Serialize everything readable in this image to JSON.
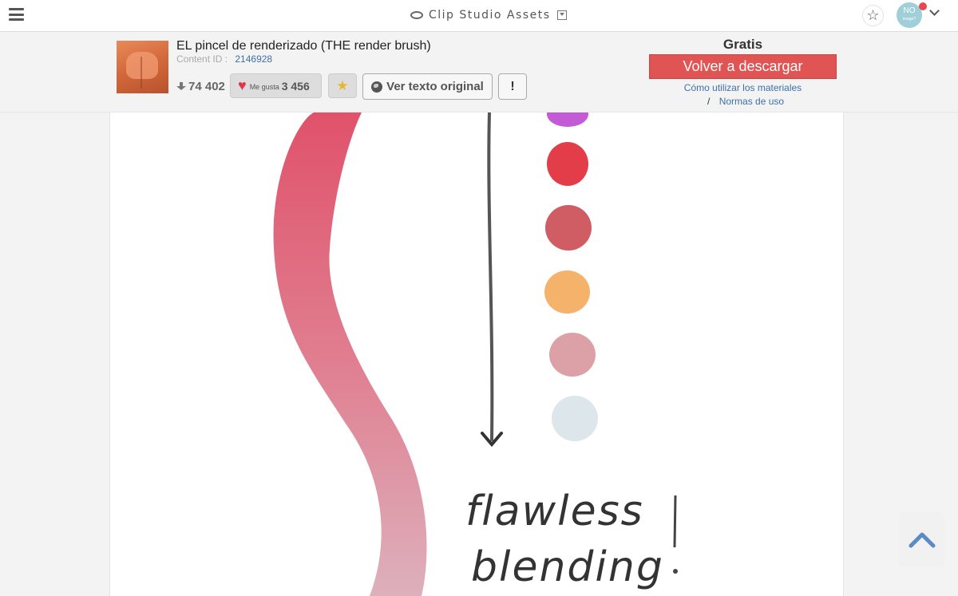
{
  "header": {
    "app_title": "Clip Studio Assets",
    "avatar_initials": "NO",
    "avatar_sub": "image?"
  },
  "item": {
    "title": "EL pincel de renderizado (THE render brush)",
    "content_id_label": "Content ID :",
    "content_id": "2146928",
    "downloads": "74 402",
    "likes_label": "Me gusta",
    "likes": "3 456",
    "view_original_label": "Ver texto original",
    "report_label": "!"
  },
  "purchase": {
    "price": "Gratis",
    "redownload_label": "Volver a descargar",
    "how_to_label": "Cómo utilizar los materiales",
    "terms_label": "Normas de uso",
    "separator": "/"
  },
  "preview": {
    "caption_line1": "flawless",
    "caption_line2": "blending",
    "swatches": [
      "#c35ad6",
      "#e23d48",
      "#cf5d63",
      "#f4b26a",
      "#dba1a6",
      "#dde7eb"
    ]
  },
  "colors": {
    "accent_red": "#e05453",
    "link_blue": "#3f6faa"
  }
}
